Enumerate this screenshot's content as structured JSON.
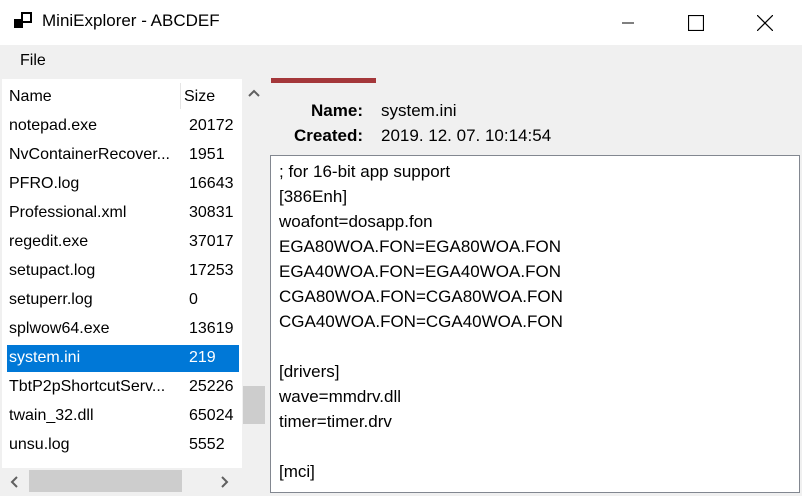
{
  "window": {
    "title": "MiniExplorer - ABCDEF"
  },
  "menu": {
    "file": "File"
  },
  "file_list": {
    "columns": {
      "name": "Name",
      "size": "Size"
    },
    "rows": [
      {
        "name": "notepad.exe",
        "size": "20172"
      },
      {
        "name": "NvContainerRecover...",
        "size": "1951"
      },
      {
        "name": "PFRO.log",
        "size": "16643"
      },
      {
        "name": "Professional.xml",
        "size": "30831"
      },
      {
        "name": "regedit.exe",
        "size": "37017"
      },
      {
        "name": "setupact.log",
        "size": "17253"
      },
      {
        "name": "setuperr.log",
        "size": "0"
      },
      {
        "name": "splwow64.exe",
        "size": "13619"
      },
      {
        "name": "system.ini",
        "size": "219"
      },
      {
        "name": "TbtP2pShortcutServ...",
        "size": "25226"
      },
      {
        "name": "twain_32.dll",
        "size": "65024"
      },
      {
        "name": "unsu.log",
        "size": "5552"
      }
    ],
    "selected_index": 8
  },
  "details": {
    "name_label": "Name:",
    "name_value": "system.ini",
    "created_label": "Created:",
    "created_value": "2019. 12. 07. 10:14:54",
    "accent_color": "#a4373a"
  },
  "content": {
    "lines": [
      "; for 16-bit app support",
      "[386Enh]",
      "woafont=dosapp.fon",
      "EGA80WOA.FON=EGA80WOA.FON",
      "EGA40WOA.FON=EGA40WOA.FON",
      "CGA80WOA.FON=CGA80WOA.FON",
      "CGA40WOA.FON=CGA40WOA.FON",
      "",
      "[drivers]",
      "wave=mmdrv.dll",
      "timer=timer.drv",
      "",
      "[mci]"
    ]
  },
  "colors": {
    "selection": "#0078d7",
    "scroll_thumb": "#cdcdcd"
  }
}
